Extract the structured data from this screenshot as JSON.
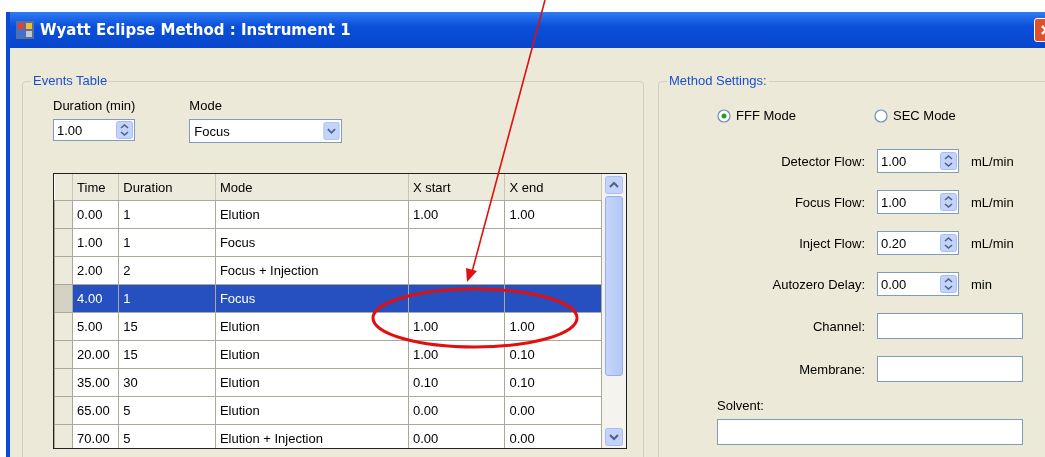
{
  "window": {
    "title": "Wyatt Eclipse Method : Instrument 1"
  },
  "events_table": {
    "title": "Events Table",
    "duration": {
      "label": "Duration (min)",
      "value": "1.00"
    },
    "mode": {
      "label": "Mode",
      "value": "Focus"
    },
    "columns": [
      "Time",
      "Duration",
      "Mode",
      "X start",
      "X end"
    ],
    "rows": [
      {
        "cells": [
          "0.00",
          "1",
          "Elution",
          "1.00",
          "1.00"
        ],
        "selected": false
      },
      {
        "cells": [
          "1.00",
          "1",
          "Focus",
          "",
          ""
        ],
        "selected": false
      },
      {
        "cells": [
          "2.00",
          "2",
          "Focus + Injection",
          "",
          ""
        ],
        "selected": false
      },
      {
        "cells": [
          "4.00",
          "1",
          "Focus",
          "",
          ""
        ],
        "selected": true
      },
      {
        "cells": [
          "5.00",
          "15",
          "Elution",
          "1.00",
          "1.00"
        ],
        "selected": false
      },
      {
        "cells": [
          "20.00",
          "15",
          "Elution",
          "1.00",
          "0.10"
        ],
        "selected": false
      },
      {
        "cells": [
          "35.00",
          "30",
          "Elution",
          "0.10",
          "0.10"
        ],
        "selected": false
      },
      {
        "cells": [
          "65.00",
          "5",
          "Elution",
          "0.00",
          "0.00"
        ],
        "selected": false
      },
      {
        "cells": [
          "70.00",
          "5",
          "Elution + Injection",
          "0.00",
          "0.00"
        ],
        "selected": false
      }
    ]
  },
  "method_settings": {
    "title": "Method Settings:",
    "modes": [
      {
        "label": "FFF Mode",
        "selected": true
      },
      {
        "label": "SEC Mode",
        "selected": false
      }
    ],
    "fields": [
      {
        "kind": "spinner",
        "label": "Detector Flow:",
        "value": "1.00",
        "unit": "mL/min"
      },
      {
        "kind": "spinner",
        "label": "Focus Flow:",
        "value": "1.00",
        "unit": "mL/min"
      },
      {
        "kind": "spinner",
        "label": "Inject Flow:",
        "value": "0.20",
        "unit": "mL/min"
      },
      {
        "kind": "spinner",
        "label": "Autozero Delay:",
        "value": "0.00",
        "unit": "min"
      },
      {
        "kind": "text",
        "label": "Channel:"
      },
      {
        "kind": "text",
        "label": "Membrane:"
      }
    ],
    "solvent": {
      "label": "Solvent:"
    }
  },
  "annotations": {
    "arrow": true,
    "ellipse": true
  }
}
